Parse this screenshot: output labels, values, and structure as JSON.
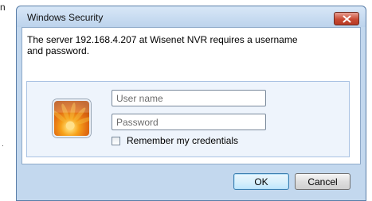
{
  "background": {
    "top_char": "n",
    "mid_char": "."
  },
  "dialog": {
    "title": "Windows Security",
    "close_icon": "close-x-icon",
    "message": "The server 192.168.4.207 at Wisenet NVR requires a username and password.",
    "username": {
      "value": "",
      "placeholder": "User name"
    },
    "password": {
      "value": "",
      "placeholder": "Password"
    },
    "remember_label": "Remember my credentials",
    "remember_checked": false,
    "ok_label": "OK",
    "cancel_label": "Cancel"
  },
  "colors": {
    "frame": "#c3d8ee",
    "close_button": "#c94b34",
    "credential_panel": "#eef4fc"
  }
}
